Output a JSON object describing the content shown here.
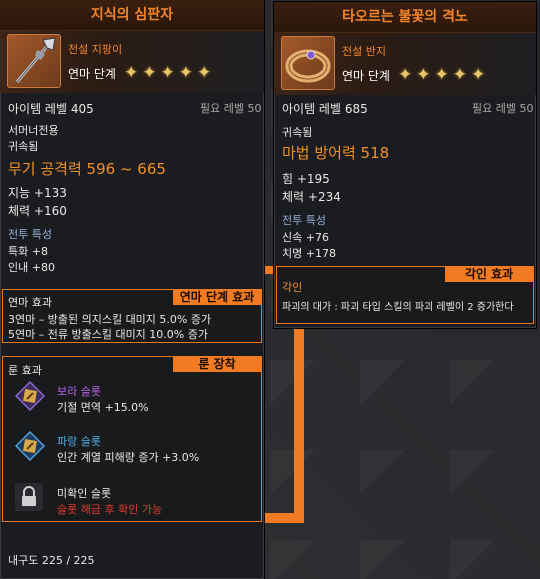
{
  "left": {
    "title": "지식의 심판자",
    "grade": "전설 지팡이",
    "enhance_label": "연마 단계",
    "item_level": "아이템 레벨 405",
    "required_level": "필요 레벨 50",
    "class_only": "서머너전용",
    "bound": "귀속됨",
    "attack": "무기 공격력 596 ~ 665",
    "stat1": "지능 +133",
    "stat2": "체력 +160",
    "combat_title": "전투 특성",
    "combat1": "특화 +8",
    "combat2": "인내 +80",
    "enhance_box": {
      "tag": "연마 단계 효과",
      "label": "연마 효과",
      "line1": "3연마 – 방출된 의지스킬 대미지 5.0% 증가",
      "line2": "5연마 – 전류 방출스킬 대미지 10.0% 증가"
    },
    "rune_box": {
      "tag": "룬 장착",
      "label": "룬 효과",
      "slots": [
        {
          "name": "보라 슬롯",
          "effect": "기절 면역 +15.0%",
          "icon": "purple-rune-icon",
          "color": "#b565e8"
        },
        {
          "name": "파랑 슬롯",
          "effect": "인간 계열 피해량 증가 +3.0%",
          "icon": "blue-rune-icon",
          "color": "#4fb0e8"
        },
        {
          "name": "미확인 슬롯",
          "effect": "슬롯 해금 후 확인 가능",
          "icon": "lock-icon",
          "color": "#e23a2a"
        }
      ]
    },
    "durability": "내구도 225 / 225"
  },
  "right": {
    "title": "타오르는 불꽃의 격노",
    "grade": "전설 반지",
    "enhance_label": "연마 단계",
    "item_level": "아이템 레벨 685",
    "required_level": "필요 레벨 50",
    "bound": "귀속됨",
    "defense": "마법 방어력 518",
    "stat1": "힘 +195",
    "stat2": "체력 +234",
    "combat_title": "전투 특성",
    "combat1": "신속 +76",
    "combat2": "치명 +178",
    "engrave_box": {
      "tag": "각인 효과",
      "label": "각인",
      "text": "파괴의 대가 : 파괴 타입 스킬의 파괴 레벨이 2 증가한다"
    }
  },
  "enhance_stars": 5,
  "colors": {
    "accent": "#f07b22",
    "legend": "#f2852d"
  }
}
